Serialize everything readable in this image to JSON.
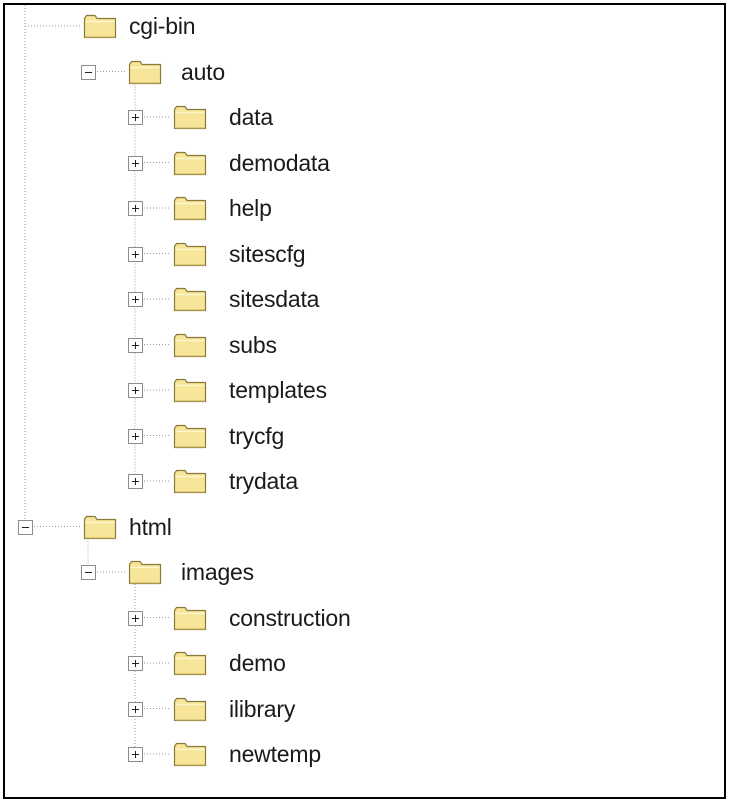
{
  "tree": [
    {
      "label": "cgi-bin",
      "depth": 1,
      "toggle": "none"
    },
    {
      "label": "auto",
      "depth": 2,
      "toggle": "expanded"
    },
    {
      "label": "data",
      "depth": 3,
      "toggle": "collapsed"
    },
    {
      "label": "demodata",
      "depth": 3,
      "toggle": "collapsed"
    },
    {
      "label": "help",
      "depth": 3,
      "toggle": "collapsed"
    },
    {
      "label": "sitescfg",
      "depth": 3,
      "toggle": "collapsed"
    },
    {
      "label": "sitesdata",
      "depth": 3,
      "toggle": "collapsed"
    },
    {
      "label": "subs",
      "depth": 3,
      "toggle": "collapsed"
    },
    {
      "label": "templates",
      "depth": 3,
      "toggle": "collapsed"
    },
    {
      "label": "trycfg",
      "depth": 3,
      "toggle": "collapsed"
    },
    {
      "label": "trydata",
      "depth": 3,
      "toggle": "collapsed"
    },
    {
      "label": "html",
      "depth": 1,
      "toggle": "expanded"
    },
    {
      "label": "images",
      "depth": 2,
      "toggle": "expanded"
    },
    {
      "label": "construction",
      "depth": 3,
      "toggle": "collapsed"
    },
    {
      "label": "demo",
      "depth": 3,
      "toggle": "collapsed"
    },
    {
      "label": "ilibrary",
      "depth": 3,
      "toggle": "collapsed"
    },
    {
      "label": "newtemp",
      "depth": 3,
      "toggle": "collapsed"
    }
  ],
  "colors": {
    "folder_fill": "#f7e59a",
    "folder_stroke": "#8a7a3a",
    "line": "#9a9a9a",
    "text": "#1a1a1a"
  }
}
